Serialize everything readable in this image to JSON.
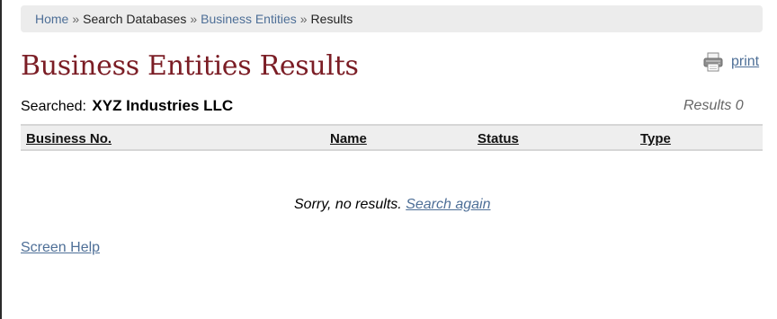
{
  "breadcrumb": {
    "items": [
      {
        "label": "Home",
        "link": true
      },
      {
        "label": "Search Databases",
        "link": false
      },
      {
        "label": "Business Entities",
        "link": true
      },
      {
        "label": "Results",
        "link": false
      }
    ],
    "separator": "»"
  },
  "page": {
    "title": "Business Entities Results",
    "print_label": "print",
    "searched_label": "Searched:",
    "searched_term": "XYZ Industries LLC",
    "results_count": "Results 0"
  },
  "table": {
    "headers": [
      "Business No.",
      "Name",
      "Status",
      "Type"
    ],
    "rows": []
  },
  "empty_state": {
    "message": "Sorry, no results.",
    "search_again_label": "Search again"
  },
  "footer": {
    "help_label": "Screen Help"
  },
  "colors": {
    "title": "#7b1d25",
    "link": "#4e6f97",
    "breadcrumb_bg": "#ececec",
    "table_header_bg": "#eeeeee"
  },
  "icons": {
    "print": "printer-icon"
  }
}
